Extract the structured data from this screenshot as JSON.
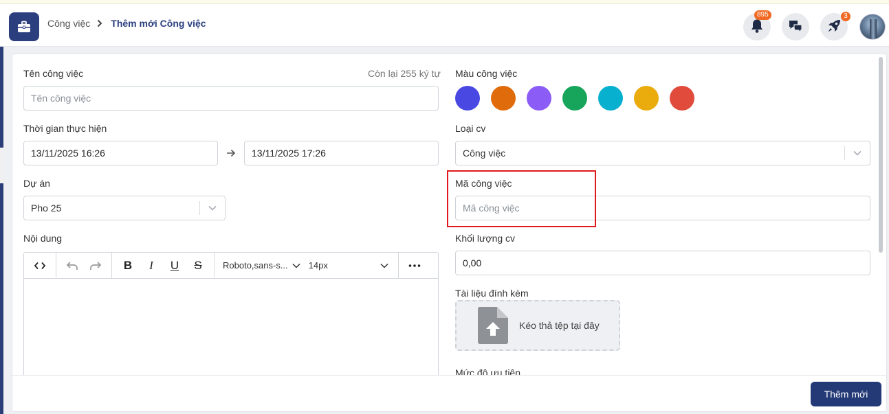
{
  "breadcrumb": {
    "parent": "Công việc",
    "current": "Thêm mới Công việc"
  },
  "header": {
    "notifications_count": "895",
    "rocket_count": "3"
  },
  "form": {
    "task_name": {
      "label": "Tên công việc",
      "remaining": "Còn lại 255 ký tự",
      "placeholder": "Tên công việc",
      "value": ""
    },
    "time": {
      "label": "Thời gian thực hiện",
      "start": "13/11/2025 16:26",
      "end": "13/11/2025 17:26"
    },
    "project": {
      "label": "Dự án",
      "value": "Pho 25"
    },
    "content": {
      "label": "Nội dung",
      "font_family": "Roboto,sans-s...",
      "font_size": "14px"
    },
    "color": {
      "label": "Màu công việc",
      "swatches": [
        "#4a48e2",
        "#e06b0b",
        "#8b5cf6",
        "#16a55a",
        "#08b0cf",
        "#eaab0c",
        "#e04b3c"
      ]
    },
    "type": {
      "label": "Loại cv",
      "value": "Công việc"
    },
    "code": {
      "label": "Mã công việc",
      "placeholder": "Mã công việc",
      "value": ""
    },
    "volume": {
      "label": "Khối lượng cv",
      "value": "0,00"
    },
    "attachment": {
      "label": "Tài liệu đính kèm",
      "dropzone": "Kéo thả tệp tại đây"
    },
    "priority": {
      "label": "Mức độ ưu tiên"
    }
  },
  "footer": {
    "submit_label": "Thêm mới"
  },
  "icons": {
    "app": "briefcase-icon",
    "notifications": "bell-icon",
    "chat": "chat-icon",
    "rocket": "rocket-icon"
  }
}
